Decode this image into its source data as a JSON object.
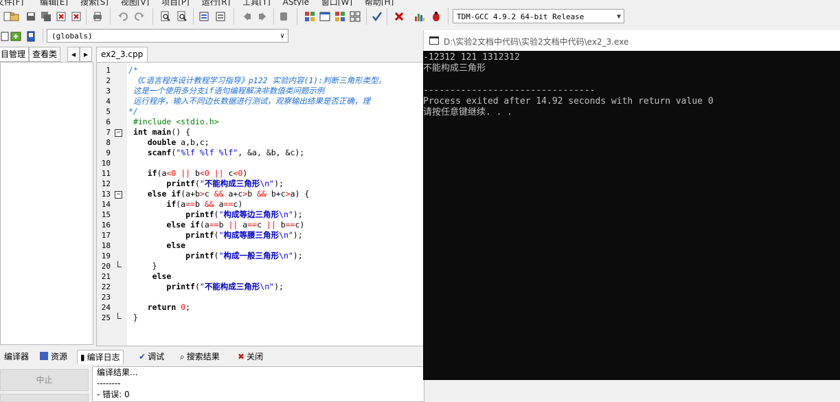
{
  "menu": [
    "文件[F]",
    "编辑[E]",
    "搜索[S]",
    "视图[V]",
    "项目[P]",
    "运行[R]",
    "工具[T]",
    "AStyle",
    "窗口[W]",
    "帮助[H]"
  ],
  "toolbar": {
    "compiler": "TDM-GCC 4.9.2 64-bit Release",
    "scope": "(globals)"
  },
  "left_tabs": [
    "目管理",
    "查看类"
  ],
  "file_tab": "ex2_3.cpp",
  "editor_lines": [
    {
      "n": "1",
      "html": "<span class=\"cm\">/*</span>"
    },
    {
      "n": "2",
      "html": "<span class=\"cm\"> 《C语言程序设计教程学习指导》p122 实验内容(1):判断三角形类型。</span>"
    },
    {
      "n": "3",
      "html": "<span class=\"cm\"> 这是一个使用多分支if语句编程解决非数值类问题示例</span>"
    },
    {
      "n": "4",
      "html": "<span class=\"cm\"> 运行程序，输入不同边长数据进行测试，观察输出结果是否正确，理</span>"
    },
    {
      "n": "5",
      "html": "<span class=\"cm\">*/</span>"
    },
    {
      "n": "6",
      "html": " <span class=\"pp\">#include &lt;stdio.h&gt;</span>"
    },
    {
      "n": "7",
      "html": " <span class=\"kw\">int</span> <span class=\"kw\">main</span>() {"
    },
    {
      "n": "8",
      "html": "    <span class=\"kw\">double</span> a,b,c;"
    },
    {
      "n": "9",
      "html": "    <span class=\"kw\">scanf</span>(<span class=\"st\">\"%lf %lf %lf\"</span>, &amp;a, &amp;b, &amp;c);"
    },
    {
      "n": "10",
      "html": ""
    },
    {
      "n": "11",
      "html": "    <span class=\"kw\">if</span>(a<span class=\"op\">&lt;</span><span class=\"nm\">0</span> <span class=\"op\">||</span> b<span class=\"op\">&lt;</span><span class=\"nm\">0</span> <span class=\"op\">||</span> c<span class=\"op\">&lt;</span><span class=\"nm\">0</span>)"
    },
    {
      "n": "12",
      "html": "        <span class=\"kw\">printf</span>(<span class=\"st\">\"</span><span class=\"cn\">不能构成三角形</span><span class=\"st\">\\n\"</span>);"
    },
    {
      "n": "13",
      "html": "    <span class=\"kw\">else</span> <span class=\"kw\">if</span>(a+b<span class=\"op\">&gt;</span>c <span class=\"op\">&amp;&amp;</span> a+c<span class=\"op\">&gt;</span>b <span class=\"op\">&amp;&amp;</span> b+c<span class=\"op\">&gt;</span>a) {"
    },
    {
      "n": "14",
      "html": "        <span class=\"kw\">if</span>(a<span class=\"op\">==</span>b <span class=\"op\">&amp;&amp;</span> a<span class=\"op\">==</span>c)"
    },
    {
      "n": "15",
      "html": "            <span class=\"kw\">printf</span>(<span class=\"st\">\"</span><span class=\"cn\">构成等边三角形</span><span class=\"st\">\\n\"</span>);"
    },
    {
      "n": "16",
      "html": "        <span class=\"kw\">else</span> <span class=\"kw\">if</span>(a<span class=\"op\">==</span>b <span class=\"op\">||</span> a<span class=\"op\">==</span>c <span class=\"op\">||</span> b<span class=\"op\">==</span>c)"
    },
    {
      "n": "17",
      "html": "            <span class=\"kw\">printf</span>(<span class=\"st\">\"</span><span class=\"cn\">构成等腰三角形</span><span class=\"st\">\\n\"</span>);"
    },
    {
      "n": "18",
      "html": "        <span class=\"kw\">else</span>"
    },
    {
      "n": "19",
      "html": "            <span class=\"kw\">printf</span>(<span class=\"st\">\"</span><span class=\"cn\">构成一般三角形</span><span class=\"st\">\\n\"</span>);"
    },
    {
      "n": "20",
      "html": "     }"
    },
    {
      "n": "21",
      "html": "     <span class=\"kw\">else</span>"
    },
    {
      "n": "22",
      "html": "        <span class=\"kw\">printf</span>(<span class=\"st\">\"</span><span class=\"cn\">不能构成三角形</span><span class=\"st\">\\n\"</span>);"
    },
    {
      "n": "23",
      "html": ""
    },
    {
      "n": "24",
      "html": "    <span class=\"kw\">return</span> <span class=\"nm\">0</span>;"
    },
    {
      "n": "25",
      "html": " }"
    }
  ],
  "bottom_tabs": [
    "编译器",
    "资源",
    "编译日志",
    "调试",
    "搜索结果",
    "关闭"
  ],
  "stop_label": "中止",
  "output_lines": [
    "编译结果...",
    "--------",
    "- 错误: 0"
  ],
  "console": {
    "title": "D:\\实验2文档中代码\\实验2文档中代码\\ex2_3.exe",
    "lines": [
      "-12312 121 1312312",
      "不能构成三角形",
      "",
      "--------------------------------",
      "Process exited after 14.92 seconds with return value 0",
      "请按任意键继续. . ."
    ]
  },
  "colors": {
    "comment": "#1e6fd9",
    "preprocessor": "#008000",
    "string": "#0000ff",
    "operator": "#ff0000",
    "console_bg": "#0c0c0c",
    "console_fg": "#c0c0c0"
  }
}
